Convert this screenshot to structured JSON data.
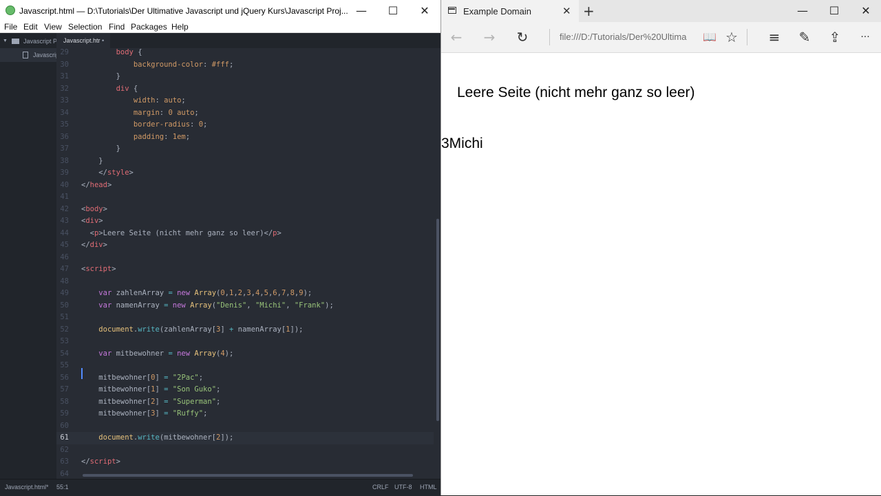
{
  "atom": {
    "title": "Javascript.html — D:\\Tutorials\\Der Ultimative Javascript und jQuery Kurs\\Javascript Proj...",
    "window_controls": {
      "minimize": "—",
      "maximize": "☐",
      "close": "✕"
    },
    "menu": [
      "File",
      "Edit",
      "View",
      "Selection",
      "Find",
      "Packages",
      "Help"
    ],
    "tree": {
      "project": "Javascript P",
      "file": "Javascript"
    },
    "tab": {
      "label": "Javascript.htr",
      "modified_dot": "•"
    },
    "status": {
      "file": "Javascript.html*",
      "position": "55:1",
      "line_ending": "CRLF",
      "encoding": "UTF-8",
      "grammar": "HTML"
    },
    "lines": [
      {
        "n": "29",
        "html": "        <span class=\"t\">body</span> {"
      },
      {
        "n": "30",
        "html": "            <span class=\"a\">background-color</span>: <span class=\"n\">#fff</span>;"
      },
      {
        "n": "31",
        "html": "        }"
      },
      {
        "n": "32",
        "html": "        <span class=\"t\">div</span> {"
      },
      {
        "n": "33",
        "html": "            <span class=\"a\">width</span>: <span class=\"n\">auto</span>;"
      },
      {
        "n": "34",
        "html": "            <span class=\"a\">margin</span>: <span class=\"n\">0</span> <span class=\"n\">auto</span>;"
      },
      {
        "n": "35",
        "html": "            <span class=\"a\">border-radius</span>: <span class=\"n\">0</span>;"
      },
      {
        "n": "36",
        "html": "            <span class=\"a\">padding</span>: <span class=\"n\">1em</span>;"
      },
      {
        "n": "37",
        "html": "        }"
      },
      {
        "n": "38",
        "html": "    }"
      },
      {
        "n": "39",
        "html": "    &lt;/<span class=\"t\">style</span>&gt;"
      },
      {
        "n": "40",
        "html": "&lt;/<span class=\"t\">head</span>&gt;"
      },
      {
        "n": "41",
        "html": ""
      },
      {
        "n": "42",
        "html": "&lt;<span class=\"t\">body</span>&gt;"
      },
      {
        "n": "43",
        "html": "&lt;<span class=\"t\">div</span>&gt;"
      },
      {
        "n": "44",
        "html": "  &lt;<span class=\"t\">p</span>&gt;Leere Seite (nicht mehr ganz so leer)&lt;/<span class=\"t\">p</span>&gt;"
      },
      {
        "n": "45",
        "html": "&lt;/<span class=\"t\">div</span>&gt;"
      },
      {
        "n": "46",
        "html": ""
      },
      {
        "n": "47",
        "html": "&lt;<span class=\"t\">script</span>&gt;"
      },
      {
        "n": "48",
        "html": ""
      },
      {
        "n": "49",
        "html": "    <span class=\"k\">var</span> zahlenArray <span class=\"o\">=</span> <span class=\"k\">new</span> <span class=\"b\">Array</span>(<span class=\"n\">0</span>,<span class=\"n\">1</span>,<span class=\"n\">2</span>,<span class=\"n\">3</span>,<span class=\"n\">4</span>,<span class=\"n\">5</span>,<span class=\"n\">6</span>,<span class=\"n\">7</span>,<span class=\"n\">8</span>,<span class=\"n\">9</span>);"
      },
      {
        "n": "50",
        "html": "    <span class=\"k\">var</span> namenArray <span class=\"o\">=</span> <span class=\"k\">new</span> <span class=\"b\">Array</span>(<span class=\"s\">\"Denis\"</span>, <span class=\"s\">\"Michi\"</span>, <span class=\"s\">\"Frank\"</span>);"
      },
      {
        "n": "51",
        "html": ""
      },
      {
        "n": "52",
        "html": "    <span class=\"b\">document</span>.<span class=\"c\">write</span>(zahlenArray[<span class=\"n\">3</span>] <span class=\"o\">+</span> namenArray[<span class=\"n\">1</span>]);"
      },
      {
        "n": "53",
        "html": ""
      },
      {
        "n": "54",
        "html": "    <span class=\"k\">var</span> mitbewohner <span class=\"o\">=</span> <span class=\"k\">new</span> <span class=\"b\">Array</span>(<span class=\"n\">4</span>);"
      },
      {
        "n": "55",
        "html": ""
      },
      {
        "n": "56",
        "html": "    mitbewohner[<span class=\"n\">0</span>] <span class=\"o\">=</span> <span class=\"s\">\"2Pac\"</span>;"
      },
      {
        "n": "57",
        "html": "    mitbewohner[<span class=\"n\">1</span>] <span class=\"o\">=</span> <span class=\"s\">\"Son Guko\"</span>;"
      },
      {
        "n": "58",
        "html": "    mitbewohner[<span class=\"n\">2</span>] <span class=\"o\">=</span> <span class=\"s\">\"Superman\"</span>;"
      },
      {
        "n": "59",
        "html": "    mitbewohner[<span class=\"n\">3</span>] <span class=\"o\">=</span> <span class=\"s\">\"Ruffy\"</span>;"
      },
      {
        "n": "60",
        "html": ""
      },
      {
        "n": "61",
        "html": "    <span class=\"b\">document</span>.<span class=\"c\">write</span>(mitbewohner[<span class=\"n\">2</span>]);",
        "current": true
      },
      {
        "n": "62",
        "html": ""
      },
      {
        "n": "63",
        "html": "&lt;/<span class=\"t\">script</span>&gt;"
      },
      {
        "n": "64",
        "html": ""
      }
    ]
  },
  "edge": {
    "tab_title": "Example Domain",
    "tab_close": "✕",
    "new_tab": "+",
    "window_controls": {
      "minimize": "—",
      "maximize": "☐",
      "close": "✕"
    },
    "url": "file:///D:/Tutorials/Der%20Ultima",
    "toolbar_icons": {
      "back": "←",
      "forward": "→",
      "refresh": "↻",
      "reading": "📖",
      "favorite": "☆",
      "hub": "≡",
      "note": "✎",
      "share": "⇪",
      "more": "···"
    },
    "page": {
      "paragraph": "Leere Seite (nicht mehr ganz so leer)",
      "written": "3Michi"
    }
  },
  "colors": {
    "editor_bg": "#282c34",
    "tag": "#e06c75",
    "string": "#98c379",
    "keyword": "#c678dd",
    "number": "#d19a66"
  }
}
